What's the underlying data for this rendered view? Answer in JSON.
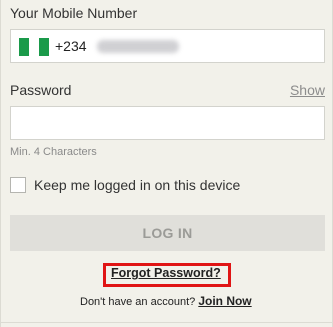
{
  "mobile": {
    "label": "Your Mobile Number",
    "dial_code": "+234",
    "flag_icon": "nigeria-flag-icon",
    "flag_colors": [
      "#1a9a4a",
      "#ffffff",
      "#1a9a4a"
    ]
  },
  "password": {
    "label": "Password",
    "show_label": "Show",
    "value": "",
    "hint": "Min. 4 Characters"
  },
  "remember": {
    "label": "Keep me logged in on this device",
    "checked": false
  },
  "login": {
    "button_label": "LOG IN"
  },
  "forgot": {
    "label": "Forgot Password?",
    "highlight_color": "#e01414"
  },
  "signup": {
    "prompt": "Don't have an account?",
    "link_label": "Join Now"
  },
  "colors": {
    "background": "#f2f1ea",
    "button_bg": "#e0dfda",
    "button_text": "#9b9b97"
  }
}
